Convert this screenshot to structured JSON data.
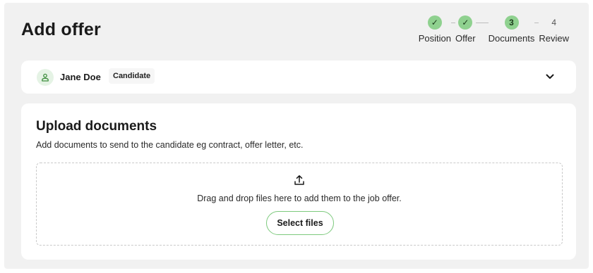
{
  "page": {
    "title": "Add offer"
  },
  "stepper": {
    "steps": [
      {
        "label": "Position",
        "marker": "✓",
        "state": "done"
      },
      {
        "label": "Offer",
        "marker": "✓",
        "state": "done"
      },
      {
        "label": "Documents",
        "marker": "3",
        "state": "active"
      },
      {
        "label": "Review",
        "marker": "4",
        "state": "todo"
      }
    ]
  },
  "candidate": {
    "name": "Jane Doe",
    "badge": "Candidate",
    "icon": "person-icon",
    "toggle_icon": "chevron-down-icon"
  },
  "upload": {
    "title": "Upload documents",
    "description": "Add documents to send to the candidate eg contract, offer letter, etc.",
    "icon": "upload-icon",
    "dropzone_text": "Drag and drop files here to add them to the job offer.",
    "button_label": "Select files"
  },
  "colors": {
    "background": "#f1f1f1",
    "card": "#ffffff",
    "accent_green": "#8fd18f",
    "button_border": "#7cc97c"
  }
}
